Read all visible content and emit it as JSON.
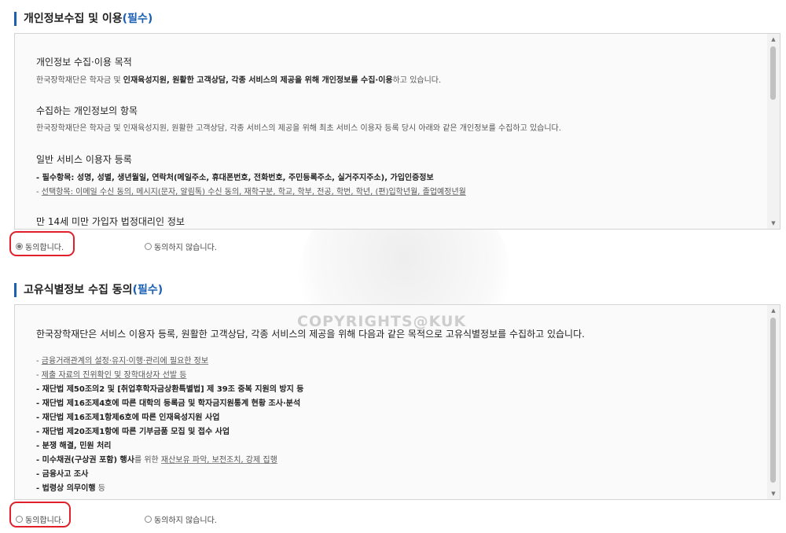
{
  "sections": [
    {
      "title": "개인정보수집 및 이용",
      "required": "(필수)",
      "content": {
        "blocks": [
          {
            "heading": "개인정보 수집·이용 목적",
            "lines": [
              {
                "parts": [
                  {
                    "text": "한국장학재단은 학자금 및 ",
                    "style": "plain"
                  },
                  {
                    "text": "인재육성지원, 원활한 고객상담, 각종 서비스의 제공을 위해 개인정보를 수집·이용",
                    "style": "bold"
                  },
                  {
                    "text": "하고 있습니다.",
                    "style": "plain"
                  }
                ]
              }
            ]
          },
          {
            "heading": "수집하는 개인정보의 항목",
            "lines": [
              {
                "parts": [
                  {
                    "text": "한국장학재단은 학자금 및 인재육성지원, 원활한 고객상담, 각종 서비스의 제공을 위해 최초 서비스 이용자 등록 당시 아래와 같은 개인정보를 수집하고 있습니다.",
                    "style": "plain"
                  }
                ]
              }
            ]
          },
          {
            "heading": "일반 서비스 이용자 등록",
            "lines": [
              {
                "parts": [
                  {
                    "text": "- 필수항목: 성명, 성별, 생년월일, 연락처(메일주소, 휴대폰번호, 전화번호, 주민등록주소, 실거주지주소), 가입인증정보",
                    "style": "bold"
                  }
                ]
              },
              {
                "parts": [
                  {
                    "text": "- ",
                    "style": "plain"
                  },
                  {
                    "text": "선택항목: 이메일 수신 동의, 메시지(문자, 알림톡) 수신 동의, 재학구분, 학교, 학부, 전공, 학번, 학년, (편)입학년월, 졸업예정년월",
                    "style": "underline"
                  }
                ]
              }
            ]
          },
          {
            "heading": "만 14세 미만 가입자 법정대리인 정보",
            "lines": []
          }
        ]
      },
      "consent": {
        "agree": "동의합니다.",
        "disagree": "동의하지 않습니다.",
        "selected": "agree"
      }
    },
    {
      "title": "고유식별정보 수집 동의",
      "required": "(필수)",
      "content": {
        "intro": "한국장학재단은 서비스 이용자 등록, 원활한 고객상담, 각종 서비스의 제공을 위해 다음과 같은 목적으로 고유식별정보를 수집하고 있습니다.",
        "items": [
          {
            "parts": [
              {
                "text": "- ",
                "style": "plain"
              },
              {
                "text": "금융거래관계의 설정·유지·이행·관리에 필요한 정보",
                "style": "underline"
              }
            ]
          },
          {
            "parts": [
              {
                "text": "- ",
                "style": "plain"
              },
              {
                "text": "제출 자료의 진위확인 및 장학대상자 선발 등",
                "style": "underline"
              }
            ]
          },
          {
            "parts": [
              {
                "text": "- 재단법 제50조의2 및 [취업후학자금상환특별법] 제 39조 중복 지원의 방지 등",
                "style": "bold"
              }
            ]
          },
          {
            "parts": [
              {
                "text": "- 재단법 제16조제4호에 따른 대학의 등록금 및 학자금지원통계 현황 조사·분석",
                "style": "bold"
              }
            ]
          },
          {
            "parts": [
              {
                "text": "- 재단법 제16조제1항제6호에 따른 인재육성지원 사업",
                "style": "bold"
              }
            ]
          },
          {
            "parts": [
              {
                "text": "- 재단법 제20조제1항에 따른 기부금품 모집 및 접수 사업",
                "style": "bold"
              }
            ]
          },
          {
            "parts": [
              {
                "text": "- 분쟁 해결, 민원 처리",
                "style": "bold"
              }
            ]
          },
          {
            "parts": [
              {
                "text": "- 미수채권(구상권 포함) 행사",
                "style": "bold"
              },
              {
                "text": "를 위한 ",
                "style": "plain"
              },
              {
                "text": "재산보유 파악, 보전조치, 강제 집행",
                "style": "underline"
              }
            ]
          },
          {
            "parts": [
              {
                "text": "- 금융사고 조사",
                "style": "bold"
              }
            ]
          },
          {
            "parts": [
              {
                "text": "- 법령상 의무이행",
                "style": "bold"
              },
              {
                "text": " 등",
                "style": "plain"
              }
            ]
          }
        ]
      },
      "consent": {
        "agree": "동의합니다.",
        "disagree": "동의하지 않습니다.",
        "selected": "none"
      }
    }
  ],
  "watermark": "COPYRIGHTS@KUK",
  "colors": {
    "accent": "#1a5fb4",
    "highlight": "#e0202a"
  }
}
